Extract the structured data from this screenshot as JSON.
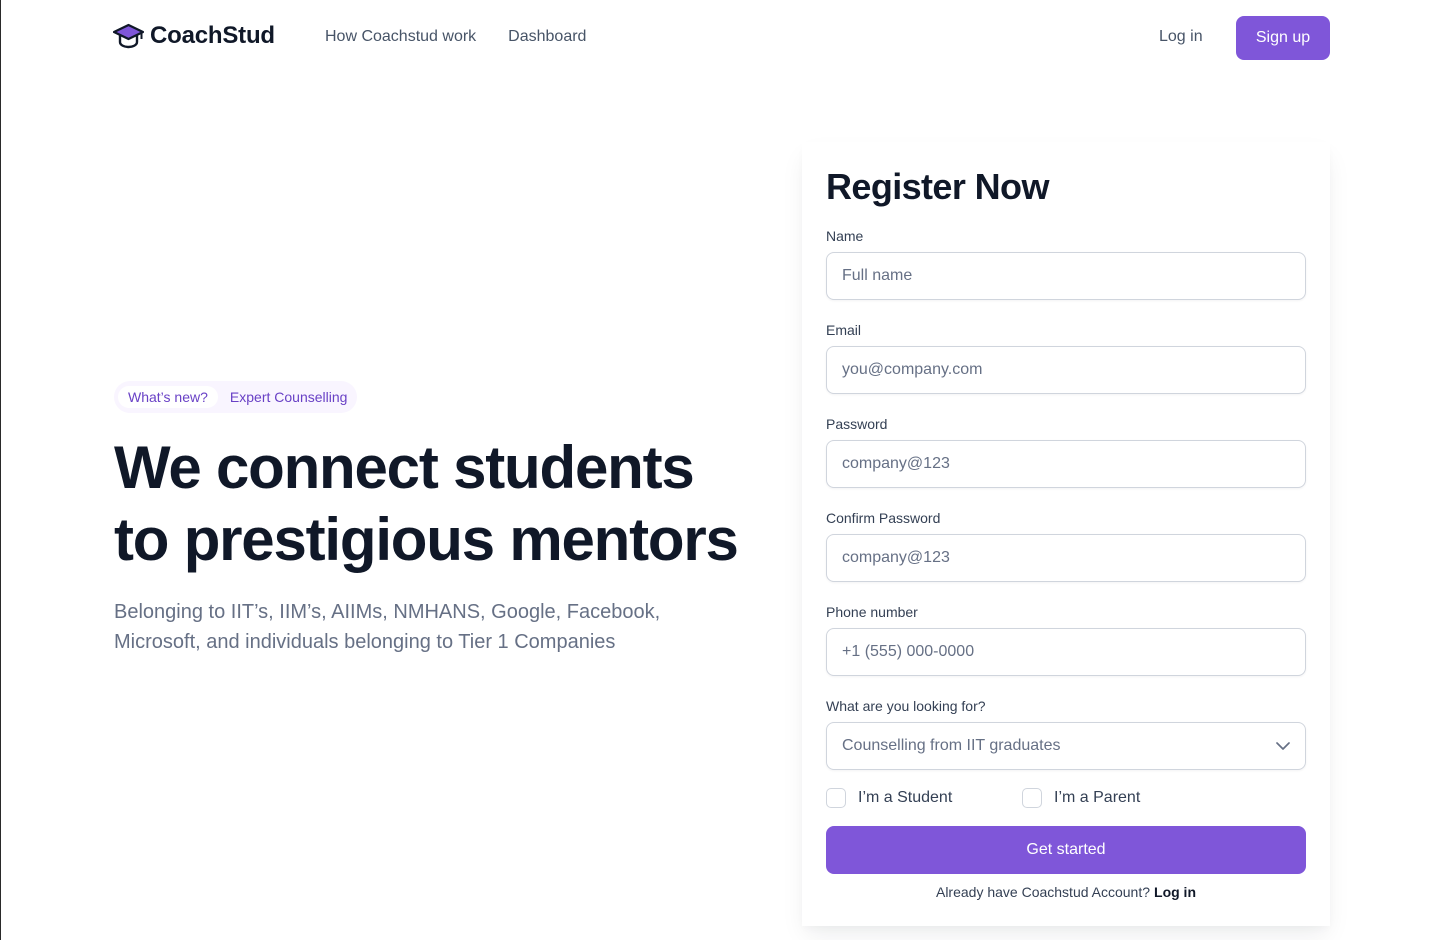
{
  "brand": {
    "name": "CoachStud",
    "icon": "graduation-cap-icon",
    "accent": "#7F56D9"
  },
  "nav": {
    "items": [
      {
        "label": "How Coachstud work"
      },
      {
        "label": "Dashboard"
      }
    ],
    "login_label": "Log in",
    "signup_label": "Sign up"
  },
  "hero": {
    "badge_tag": "What’s new?",
    "badge_text": "Expert Counselling",
    "title_line1": "We connect students",
    "title_line2": "to prestigious mentors",
    "subtitle": "Belonging to IIT’s, IIM’s, AIIMs, NMHANS, Google, Facebook, Microsoft, and individuals belonging to Tier 1 Companies"
  },
  "form": {
    "title": "Register Now",
    "fields": [
      {
        "label": "Name",
        "placeholder": "Full name"
      },
      {
        "label": "Email",
        "placeholder": "you@company.com"
      },
      {
        "label": "Password",
        "placeholder": "company@123"
      },
      {
        "label": "Confirm Password",
        "placeholder": "company@123"
      },
      {
        "label": "Phone number",
        "placeholder": "+1 (555) 000-0000"
      }
    ],
    "select_label": "What are you looking for?",
    "select_value": "Counselling from IIT graduates",
    "checkboxes": [
      {
        "label": "I’m a Student",
        "checked": false
      },
      {
        "label": "I’m a Parent",
        "checked": false
      }
    ],
    "submit_label": "Get started",
    "footer_text": "Already have Coachstud Account?",
    "footer_link": "Log in"
  }
}
